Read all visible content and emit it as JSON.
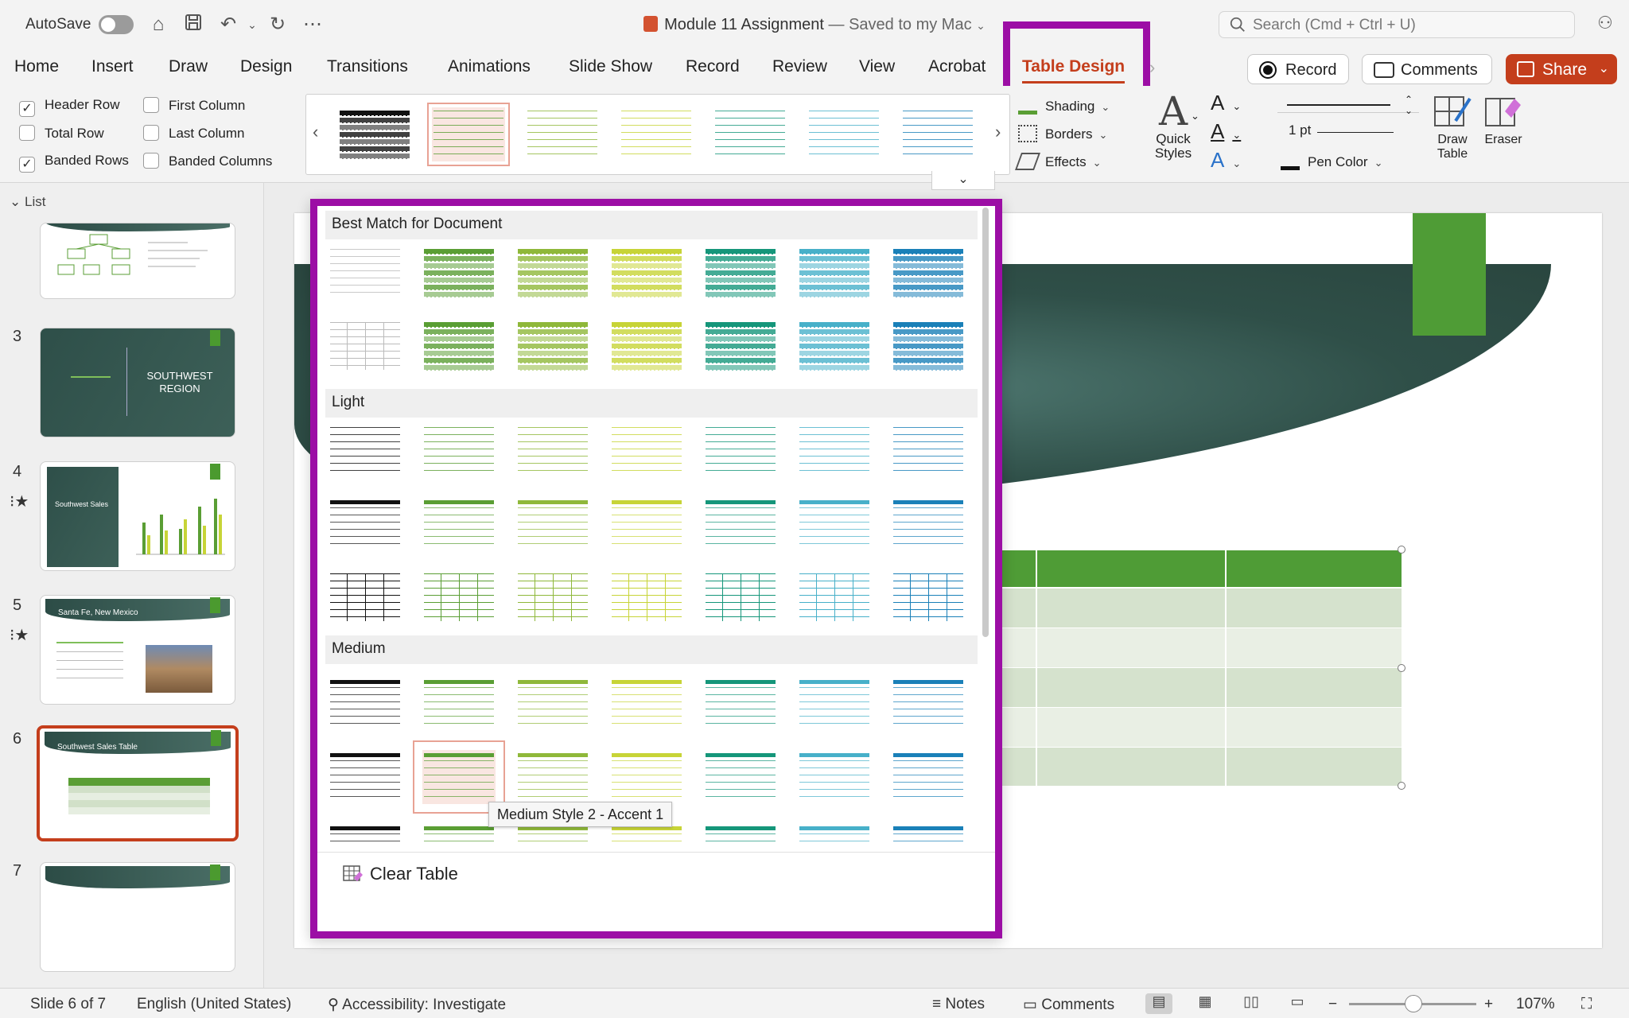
{
  "titlebar": {
    "autosave_label": "AutoSave",
    "doc_name": "Module 11 Assignment",
    "doc_status": "— Saved to my Mac",
    "search_placeholder": "Search (Cmd + Ctrl + U)"
  },
  "tabs": [
    {
      "label": "Home"
    },
    {
      "label": "Insert"
    },
    {
      "label": "Draw"
    },
    {
      "label": "Design"
    },
    {
      "label": "Transitions"
    },
    {
      "label": "Animations"
    },
    {
      "label": "Slide Show"
    },
    {
      "label": "Record"
    },
    {
      "label": "Review"
    },
    {
      "label": "View"
    },
    {
      "label": "Acrobat"
    },
    {
      "label": "Table Design",
      "active": true
    }
  ],
  "actions": {
    "record": "Record",
    "comments": "Comments",
    "share": "Share"
  },
  "ribbon": {
    "style_options": [
      {
        "label": "Header Row",
        "checked": true
      },
      {
        "label": "Total Row",
        "checked": false
      },
      {
        "label": "Banded Rows",
        "checked": true
      },
      {
        "label": "First Column",
        "checked": false
      },
      {
        "label": "Last Column",
        "checked": false
      },
      {
        "label": "Banded Columns",
        "checked": false
      }
    ],
    "shading": "Shading",
    "borders": "Borders",
    "effects": "Effects",
    "quick_styles": "Quick Styles",
    "pen_weight": "1 pt",
    "pen_color": "Pen Color",
    "draw_table": "Draw Table",
    "eraser": "Eraser"
  },
  "panel": {
    "list_label": "List",
    "slides": [
      {
        "num": "",
        "title": ""
      },
      {
        "num": "3",
        "title": "SOUTHWEST REGION"
      },
      {
        "num": "4",
        "title": "Southwest Sales",
        "star": true
      },
      {
        "num": "5",
        "title": "Santa Fe, New Mexico",
        "star": true
      },
      {
        "num": "6",
        "title": "Southwest Sales Table",
        "selected": true
      },
      {
        "num": "7",
        "title": ""
      }
    ]
  },
  "gallery": {
    "sections": [
      "Best Match for Document",
      "Light",
      "Medium"
    ],
    "tooltip": "Medium Style 2 - Accent 1",
    "clear_table": "Clear Table"
  },
  "colors": {
    "accent": "#c43e1c",
    "highlight": "#9c0ea5",
    "palette": [
      "#111111",
      "#5a9e34",
      "#8fb83a",
      "#c7d437",
      "#15967a",
      "#47b0c9",
      "#1a80b8"
    ]
  },
  "statusbar": {
    "slide_info": "Slide 6 of 7",
    "language": "English (United States)",
    "accessibility": "Accessibility: Investigate",
    "notes": "Notes",
    "comments": "Comments",
    "zoom": "107%"
  }
}
